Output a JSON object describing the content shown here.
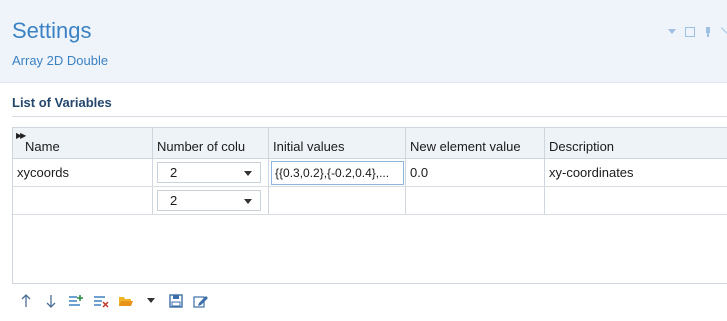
{
  "window": {
    "title": "Settings",
    "subtitle": "Array 2D Double"
  },
  "section": {
    "title": "List of Variables"
  },
  "table": {
    "columns": [
      "Name",
      "Number of colu",
      "Initial values",
      "New element value",
      "Description"
    ],
    "rows": [
      {
        "name": "xycoords",
        "num_columns": "2",
        "initial_values": "{{0.3,0.2},{-0.2,0.4},...",
        "new_element_value": "0.0",
        "description": "xy-coordinates"
      },
      {
        "name": "",
        "num_columns": "2",
        "initial_values": "",
        "new_element_value": "",
        "description": ""
      }
    ]
  },
  "toolbar": {
    "icons": [
      "arrow-up-icon",
      "arrow-down-icon",
      "add-rows-icon",
      "delete-rows-icon",
      "open-folder-icon",
      "dropdown-arrow-icon",
      "save-icon",
      "edit-icon"
    ]
  },
  "colors": {
    "accent": "#3b82c4",
    "header_bg": "#eef4fa",
    "section_title": "#23476d"
  }
}
